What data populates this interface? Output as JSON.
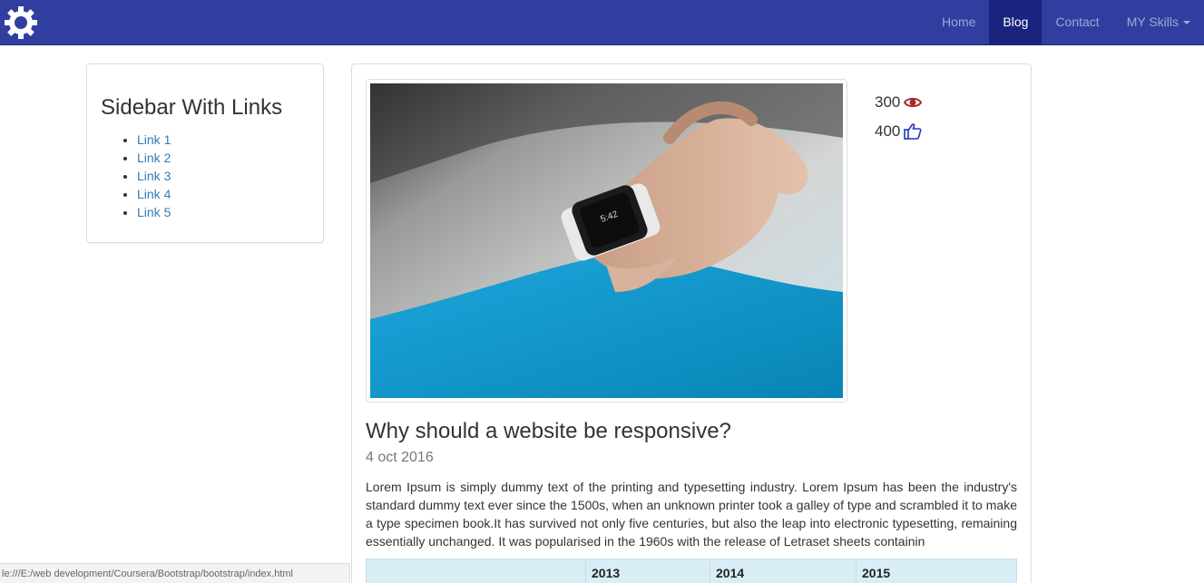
{
  "navbar": {
    "brand_icon": "gear-icon",
    "items": [
      {
        "label": "Home",
        "active": false
      },
      {
        "label": "Blog",
        "active": true
      },
      {
        "label": "Contact",
        "active": false
      },
      {
        "label": "MY Skills",
        "active": false,
        "dropdown": true
      }
    ],
    "colors": {
      "background": "#303f9f",
      "active": "#1a237e"
    }
  },
  "sidebar": {
    "title": "Sidebar With Links",
    "links": [
      "Link 1",
      "Link 2",
      "Link 3",
      "Link 4",
      "Link 5"
    ]
  },
  "post": {
    "views": "300",
    "views_icon": "eye-icon",
    "likes": "400",
    "likes_icon": "thumbs-up-icon",
    "title": "Why should a website be responsive?",
    "date": "4 oct 2016",
    "body": "Lorem Ipsum is simply dummy text of the printing and typesetting industry. Lorem Ipsum has been the industry's standard dummy text ever since the 1500s, when an unknown printer took a galley of type and scrambled it to make a type specimen book.It has survived not only five centuries, but also the leap into electronic typesetting, remaining essentially unchanged. It was popularised in the 1960s with the release of Letraset sheets containin",
    "table_headers": [
      "",
      "2013",
      "2014",
      "2015"
    ]
  },
  "statusbar": {
    "url": "le:///E:/web development/Coursera/Bootstrap/bootstrap/index.html"
  }
}
